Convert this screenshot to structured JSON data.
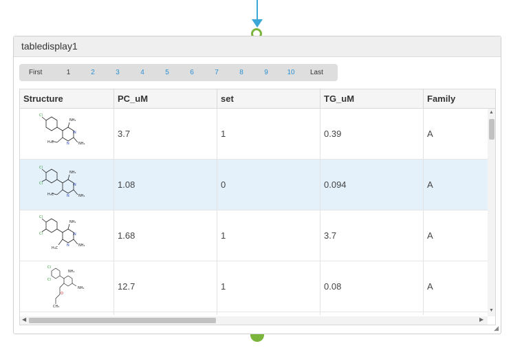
{
  "node": {
    "title": "tabledisplay1"
  },
  "pager": {
    "first": "First",
    "current": "1",
    "pages": [
      "2",
      "3",
      "4",
      "5",
      "6",
      "7",
      "8",
      "9",
      "10"
    ],
    "last": "Last"
  },
  "table": {
    "columns": [
      "Structure",
      "PC_uM",
      "set",
      "TG_uM",
      "Family"
    ],
    "rows": [
      {
        "structure": "compound-1",
        "pc_um": "3.7",
        "set": "1",
        "tg_um": "0.39",
        "family": "A"
      },
      {
        "structure": "compound-2",
        "pc_um": "1.08",
        "set": "0",
        "tg_um": "0.094",
        "family": "A"
      },
      {
        "structure": "compound-3",
        "pc_um": "1.68",
        "set": "1",
        "tg_um": "3.7",
        "family": "A"
      },
      {
        "structure": "compound-4",
        "pc_um": "12.7",
        "set": "1",
        "tg_um": "0.08",
        "family": "A"
      }
    ]
  },
  "colors": {
    "link": "#2b8fd3",
    "highlight": "#e4f1fb",
    "port": "#7cb53c",
    "connector": "#3aa7d6"
  }
}
